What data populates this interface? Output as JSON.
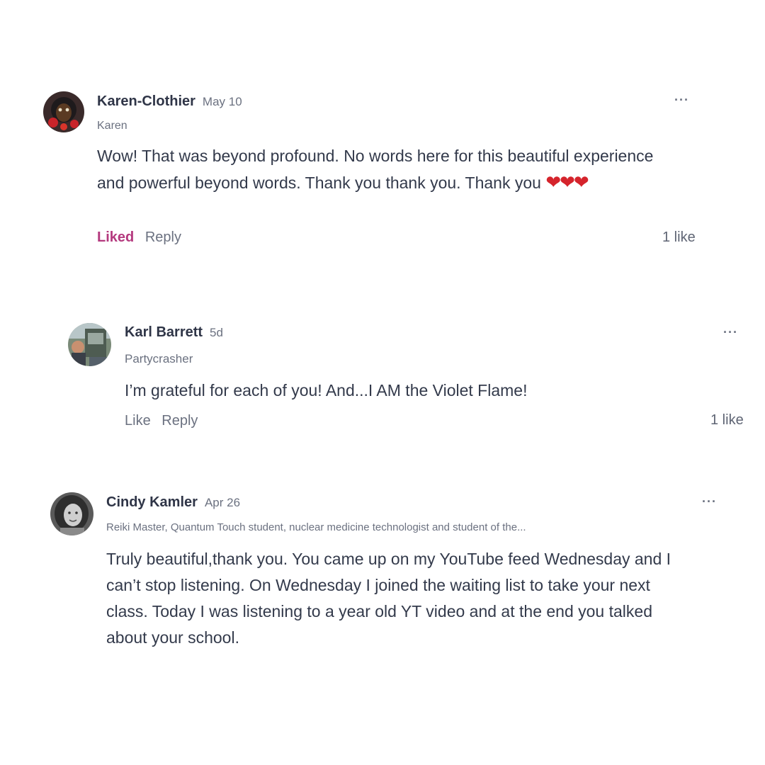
{
  "comments": [
    {
      "author": "Karen-Clothier",
      "date": "May 10",
      "subtitle": "Karen",
      "body": "Wow! That was beyond profound. No words here for this beautiful experience and powerful beyond words. Thank you thank you. Thank you",
      "hearts": "❤❤❤",
      "like_label": "Liked",
      "reply_label": "Reply",
      "like_count": "1 like",
      "more_label": "···"
    },
    {
      "author": "Karl Barrett",
      "date": "5d",
      "subtitle": "Partycrasher",
      "body": "I’m grateful for each of you! And...I AM the Violet Flame!",
      "like_label": "Like",
      "reply_label": "Reply",
      "like_count": "1 like",
      "more_label": "···"
    },
    {
      "author": "Cindy Kamler",
      "date": "Apr 26",
      "subtitle": "Reiki Master, Quantum Touch student, nuclear medicine technologist and student of the...",
      "body": "Truly beautiful,thank you. You came up on my YouTube feed Wednesday and I can’t stop listening. On Wednesday I joined the waiting list to take your next class. Today I was listening to a year old YT video and at the end you talked about your school.",
      "more_label": "···"
    }
  ],
  "colors": {
    "liked_accent": "#b4397e",
    "heart": "#d5242c",
    "text": "#333a4b",
    "muted": "#6b7180"
  }
}
